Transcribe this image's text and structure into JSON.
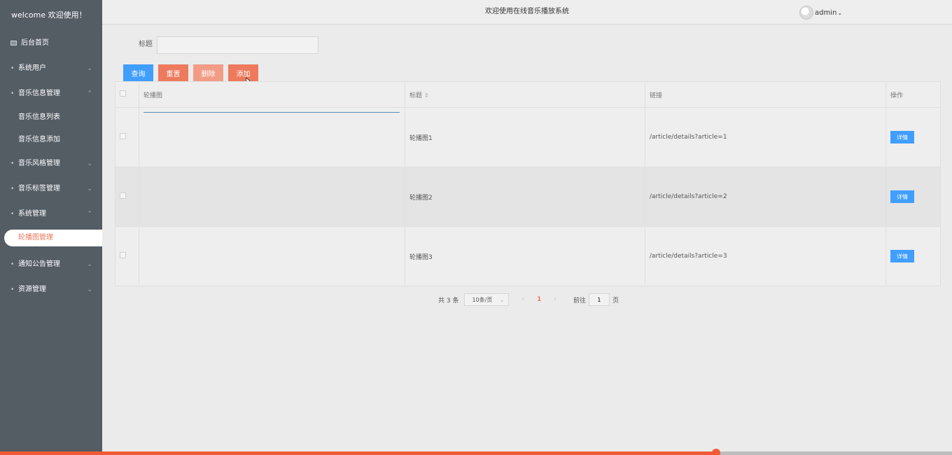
{
  "sidebar": {
    "brand": "welcome 欢迎使用！",
    "items": [
      {
        "label": "后台首页"
      },
      {
        "label": "系统用户"
      },
      {
        "label": "音乐信息管理",
        "sub": [
          "音乐信息列表",
          "音乐信息添加"
        ]
      },
      {
        "label": "音乐风格管理"
      },
      {
        "label": "音乐标签管理"
      },
      {
        "label": "系统管理",
        "sub": [
          "轮播图管理"
        ]
      },
      {
        "label": "通知公告管理"
      },
      {
        "label": "资源管理"
      }
    ]
  },
  "header": {
    "title": "欢迎使用在线音乐播放系统",
    "user": "admin"
  },
  "search": {
    "label": "标题",
    "value": ""
  },
  "toolbar": {
    "query": "查询",
    "reset": "重置",
    "delete": "删除",
    "add": "添加"
  },
  "table": {
    "columns": [
      "轮播图",
      "标题",
      "链接",
      "操作"
    ],
    "rows": [
      {
        "title": "轮播图1",
        "link": "/article/details?article=1",
        "action": "详情"
      },
      {
        "title": "轮播图2",
        "link": "/article/details?article=2",
        "action": "详情"
      },
      {
        "title": "轮播图3",
        "link": "/article/details?article=3",
        "action": "详情"
      }
    ]
  },
  "pagination": {
    "total": "共 3 条",
    "page_size": "10条/页",
    "current_page": "1",
    "goto_label": "前往",
    "goto_value": "1",
    "goto_suffix": "页"
  },
  "progress": {
    "fraction": 0.752
  },
  "colors": {
    "sidebar": "#545c64",
    "primary": "#409eff",
    "accent": "#ee7a5d",
    "progress": "#f05b34"
  }
}
